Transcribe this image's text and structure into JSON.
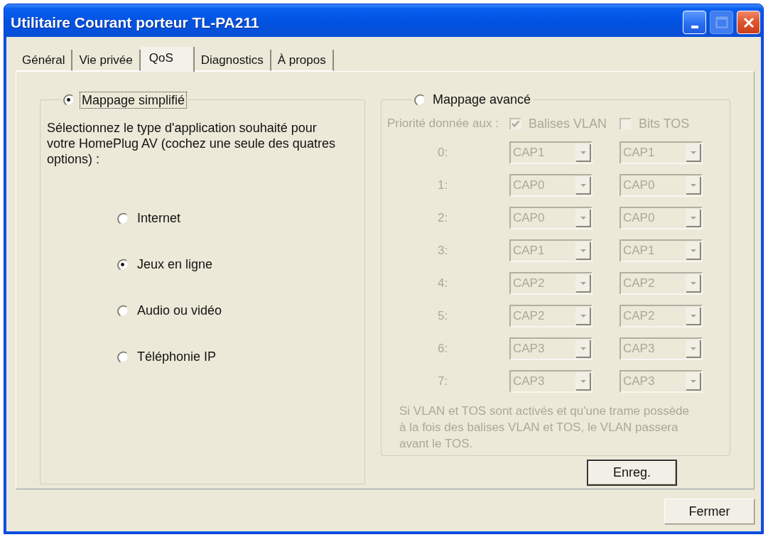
{
  "window": {
    "title": "Utilitaire Courant porteur TL-PA211",
    "buttons": [
      {
        "kind": "minimize",
        "disabled": false
      },
      {
        "kind": "maximize",
        "disabled": true
      },
      {
        "kind": "close",
        "disabled": false
      }
    ]
  },
  "tabs": [
    {
      "label": "Général",
      "selected": false
    },
    {
      "label": "Vie privée",
      "selected": false
    },
    {
      "label": "QoS",
      "selected": true
    },
    {
      "label": "Diagnostics",
      "selected": false
    },
    {
      "label": "À propos",
      "selected": false
    }
  ],
  "simple_mapping": {
    "label": "Mappage simplifié",
    "selected": true,
    "focused": true,
    "instructions": "Sélectionnez le type d'application souhaité pour votre HomePlug AV (cochez une seule des quatres options) :",
    "options": [
      {
        "label": "Internet",
        "selected": false
      },
      {
        "label": "Jeux en ligne",
        "selected": true
      },
      {
        "label": "Audio ou vidéo",
        "selected": false
      },
      {
        "label": "Téléphonie IP",
        "selected": false
      }
    ]
  },
  "advanced_mapping": {
    "label": "Mappage avancé",
    "selected": false,
    "disabled": true,
    "priority_label": "Priorité donnée aux :",
    "checkboxes": [
      {
        "label": "Balises VLAN",
        "checked": true
      },
      {
        "label": "Bits TOS",
        "checked": false
      }
    ],
    "rows": [
      {
        "label": "0:",
        "values": [
          "CAP1",
          "CAP1"
        ]
      },
      {
        "label": "1:",
        "values": [
          "CAP0",
          "CAP0"
        ]
      },
      {
        "label": "2:",
        "values": [
          "CAP0",
          "CAP0"
        ]
      },
      {
        "label": "3:",
        "values": [
          "CAP1",
          "CAP1"
        ]
      },
      {
        "label": "4:",
        "values": [
          "CAP2",
          "CAP2"
        ]
      },
      {
        "label": "5:",
        "values": [
          "CAP2",
          "CAP2"
        ]
      },
      {
        "label": "6:",
        "values": [
          "CAP3",
          "CAP3"
        ]
      },
      {
        "label": "7:",
        "values": [
          "CAP3",
          "CAP3"
        ]
      }
    ],
    "note": "Si VLAN et TOS sont activés et qu'une trame possède à la fois des balises VLAN et TOS, le VLAN passera avant le TOS."
  },
  "save_button": {
    "label": "Enreg.",
    "default": true
  },
  "close_button": {
    "label": "Fermer",
    "default": false
  }
}
